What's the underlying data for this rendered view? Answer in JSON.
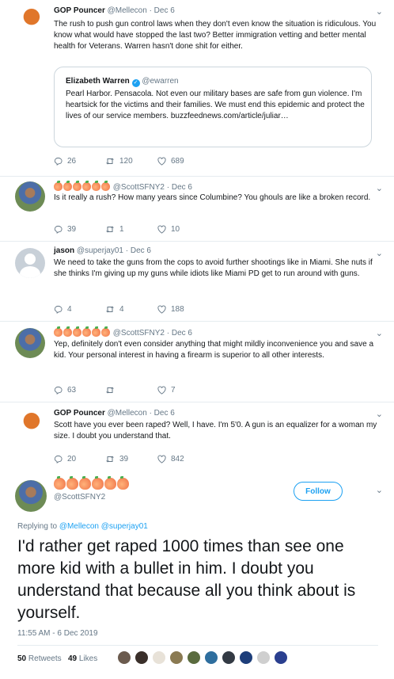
{
  "tweets": [
    {
      "name": "GOP Pouncer",
      "handle": "@Mellecon",
      "date": "· Dec 6",
      "text": "The rush to push gun control laws when they don't even know the situation is ridiculous.  You know what would have stopped the last two?  Better immigration vetting and better mental health for Veterans. Warren hasn't done shit for either.",
      "quote": {
        "name": "Elizabeth Warren",
        "handle": "@ewarren",
        "text": "Pearl Harbor. Pensacola. Not even our military bases are safe from gun violence. I'm heartsick for the victims and their families. We must end this epidemic and protect the lives of our service members. buzzfeednews.com/article/juliar…"
      },
      "replies": "26",
      "retweets": "120",
      "likes": "689"
    },
    {
      "name": "",
      "handle": "@ScottSFNY2",
      "date": "· Dec 6",
      "text": "Is it really a rush? How many years since Columbine? You ghouls are like a broken record.",
      "replies": "39",
      "retweets": "1",
      "likes": "10"
    },
    {
      "name": "jason",
      "handle": "@superjay01",
      "date": "· Dec 6",
      "text": "We need to take the guns from the cops to avoid further shootings like in Miami. She nuts if she thinks I'm giving up my guns while idiots like Miami PD get to run around with guns.",
      "replies": "4",
      "retweets": "4",
      "likes": "188"
    },
    {
      "name": "",
      "handle": "@ScottSFNY2",
      "date": "· Dec 6",
      "text": "Yep, definitely don't even consider anything that might mildly inconvenience you and save a kid. Your personal interest in having a firearm is superior to all other interests.",
      "replies": "63",
      "retweets": "",
      "likes": "7"
    },
    {
      "name": "GOP Pouncer",
      "handle": "@Mellecon",
      "date": "· Dec 6",
      "text": "Scott have you ever been raped?  Well, I have. I'm 5'0. A gun is an equalizer for a woman my size.  I doubt you understand that.",
      "replies": "20",
      "retweets": "39",
      "likes": "842"
    }
  ],
  "main": {
    "handle": "@ScottSFNY2",
    "follow_label": "Follow",
    "replying_prefix": "Replying to",
    "replying_to_1": "@Mellecon",
    "replying_to_2": "@superjay01",
    "text": "I'd rather get raped 1000 times than see one more kid with a bullet in him. I doubt you understand that because all you think about is yourself.",
    "timestamp": "11:55 AM - 6 Dec 2019",
    "retweets_count": "50",
    "retweets_label": "Retweets",
    "likes_count": "49",
    "likes_label": "Likes"
  },
  "colors": {
    "accent": "#1da1f2",
    "muted": "#657786",
    "text": "#14171a",
    "border": "#e6ecf0"
  }
}
